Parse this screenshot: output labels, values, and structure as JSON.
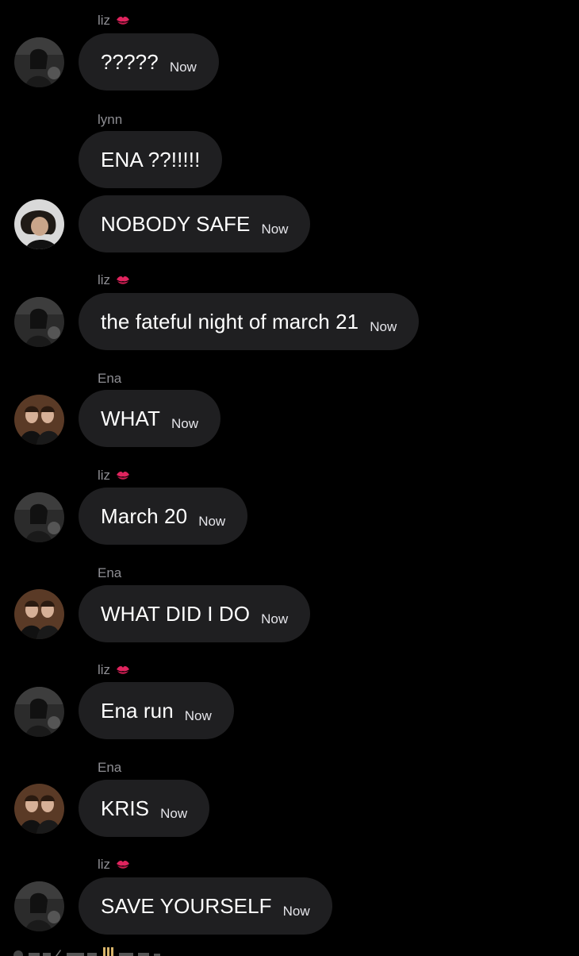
{
  "messages": [
    {
      "sender": "liz",
      "sender_emoji": "kiss-mark",
      "text": "?????",
      "time": "Now",
      "avatar": "liz"
    },
    {
      "sender": "lynn",
      "text": "ENA ??!!!!!",
      "time": "",
      "avatar": ""
    },
    {
      "sender": "",
      "text": "NOBODY SAFE",
      "time": "Now",
      "avatar": "lynn"
    },
    {
      "sender": "liz",
      "sender_emoji": "kiss-mark",
      "text": "the fateful night of march 21",
      "time": "Now",
      "avatar": "liz"
    },
    {
      "sender": "Ena",
      "text": "WHAT",
      "time": "Now",
      "avatar": "ena"
    },
    {
      "sender": "liz",
      "sender_emoji": "kiss-mark",
      "text": "March 20",
      "time": "Now",
      "avatar": "liz"
    },
    {
      "sender": "Ena",
      "text": "WHAT DID I DO",
      "time": "Now",
      "avatar": "ena"
    },
    {
      "sender": "liz",
      "sender_emoji": "kiss-mark",
      "text": "Ena run",
      "time": "Now",
      "avatar": "liz"
    },
    {
      "sender": "Ena",
      "text": "KRIS",
      "time": "Now",
      "avatar": "ena"
    },
    {
      "sender": "liz",
      "sender_emoji": "kiss-mark",
      "text": "SAVE YOURSELF",
      "time": "Now",
      "avatar": "liz"
    }
  ],
  "colors": {
    "background": "#000000",
    "bubble": "#1f1f21",
    "sender_name": "#8e8e93",
    "kiss_mark": "#e0245e"
  }
}
